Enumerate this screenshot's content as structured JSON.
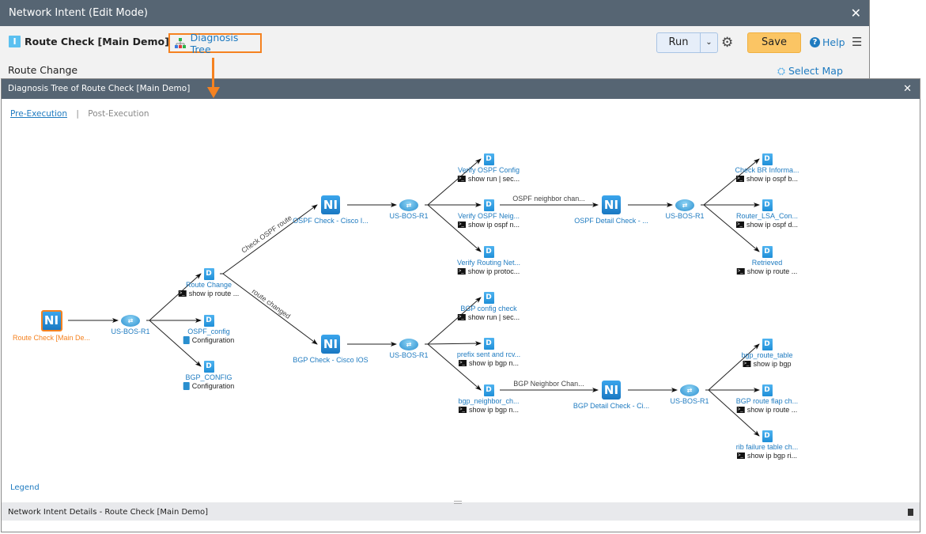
{
  "window": {
    "title": "Network Intent (Edit Mode)",
    "close_icon": "close-icon"
  },
  "toolbar": {
    "intent_name": "Route Check [Main Demo]",
    "diagnosis_tree_label": "Diagnosis Tree",
    "run_label": "Run",
    "save_label": "Save",
    "help_label": "Help",
    "select_map_label": "Select Map",
    "subtitle": "Route Change"
  },
  "dialog": {
    "title": "Diagnosis Tree of Route Check [Main Demo]",
    "tabs": [
      "Pre-Execution",
      "Post-Execution"
    ],
    "legend_label": "Legend",
    "footer_title": "Network Intent Details - Route Check [Main Demo]"
  },
  "colors": {
    "accent": "#1f7bc0",
    "highlight": "#f58220",
    "save": "#fbc564",
    "titlebar": "#566573"
  },
  "tree": {
    "nodes": [
      {
        "type": "ni",
        "label": "Route Check [Main De...",
        "root": true
      },
      {
        "type": "router",
        "label": "US-BOS-R1"
      },
      {
        "type": "d",
        "label": "Route Change",
        "sub": "show ip route ...",
        "sub_icon": "terminal"
      },
      {
        "type": "d",
        "label": "OSPF_config",
        "sub": "Configuration",
        "sub_icon": "config"
      },
      {
        "type": "d",
        "label": "BGP_CONFIG",
        "sub": "Configuration",
        "sub_icon": "config"
      },
      {
        "type": "ni",
        "label": "OSPF Check - Cisco I..."
      },
      {
        "type": "ni",
        "label": "BGP Check - Cisco IOS"
      },
      {
        "type": "router",
        "label": "US-BOS-R1"
      },
      {
        "type": "router",
        "label": "US-BOS-R1"
      },
      {
        "type": "d",
        "label": "Verify OSPF Config",
        "sub": "show run | sec...",
        "sub_icon": "terminal"
      },
      {
        "type": "d",
        "label": "Verify OSPF Neig...",
        "sub": "show ip ospf n...",
        "sub_icon": "terminal"
      },
      {
        "type": "d",
        "label": "Verify Routing Net...",
        "sub": "show ip protoc...",
        "sub_icon": "terminal"
      },
      {
        "type": "ni",
        "label": "OSPF Detail Check - ..."
      },
      {
        "type": "router",
        "label": "US-BOS-R1"
      },
      {
        "type": "d",
        "label": "Check BR Informa...",
        "sub": "show ip ospf b...",
        "sub_icon": "terminal"
      },
      {
        "type": "d",
        "label": "Router_LSA_Con...",
        "sub": "show ip ospf d...",
        "sub_icon": "terminal"
      },
      {
        "type": "d",
        "label": "Retrieved",
        "sub": "show ip route ...",
        "sub_icon": "terminal"
      },
      {
        "type": "d",
        "label": "BGP config check",
        "sub": "show run | sec...",
        "sub_icon": "terminal"
      },
      {
        "type": "d",
        "label": "prefix sent and rcv...",
        "sub": "show ip bgp n...",
        "sub_icon": "terminal"
      },
      {
        "type": "d",
        "label": "bgp_neighbor_ch...",
        "sub": "show ip bgp n...",
        "sub_icon": "terminal"
      },
      {
        "type": "ni",
        "label": "BGP Detail Check - Ci..."
      },
      {
        "type": "router",
        "label": "US-BOS-R1"
      },
      {
        "type": "d",
        "label": "bgp_route_table",
        "sub": "show ip bgp",
        "sub_icon": "terminal"
      },
      {
        "type": "d",
        "label": "BGP route flap ch...",
        "sub": "show ip route ...",
        "sub_icon": "terminal"
      },
      {
        "type": "d",
        "label": "rib failure table ch...",
        "sub": "show ip bgp ri...",
        "sub_icon": "terminal"
      }
    ],
    "edges": [
      {
        "from": 0,
        "to": 1
      },
      {
        "from": 1,
        "to": 2
      },
      {
        "from": 1,
        "to": 3
      },
      {
        "from": 1,
        "to": 4
      },
      {
        "from": 2,
        "to": 5,
        "label": "Check OSPF route"
      },
      {
        "from": 2,
        "to": 6,
        "label": "route changed"
      },
      {
        "from": 5,
        "to": 7
      },
      {
        "from": 6,
        "to": 8
      },
      {
        "from": 7,
        "to": 9
      },
      {
        "from": 7,
        "to": 10
      },
      {
        "from": 7,
        "to": 11
      },
      {
        "from": 10,
        "to": 12,
        "label": "OSPF neighbor chan..."
      },
      {
        "from": 12,
        "to": 13
      },
      {
        "from": 13,
        "to": 14
      },
      {
        "from": 13,
        "to": 15
      },
      {
        "from": 13,
        "to": 16
      },
      {
        "from": 8,
        "to": 17
      },
      {
        "from": 8,
        "to": 18
      },
      {
        "from": 8,
        "to": 19
      },
      {
        "from": 19,
        "to": 20,
        "label": "BGP Neighbor Chan..."
      },
      {
        "from": 20,
        "to": 21
      },
      {
        "from": 21,
        "to": 22
      },
      {
        "from": 21,
        "to": 23
      },
      {
        "from": 21,
        "to": 24
      }
    ]
  }
}
